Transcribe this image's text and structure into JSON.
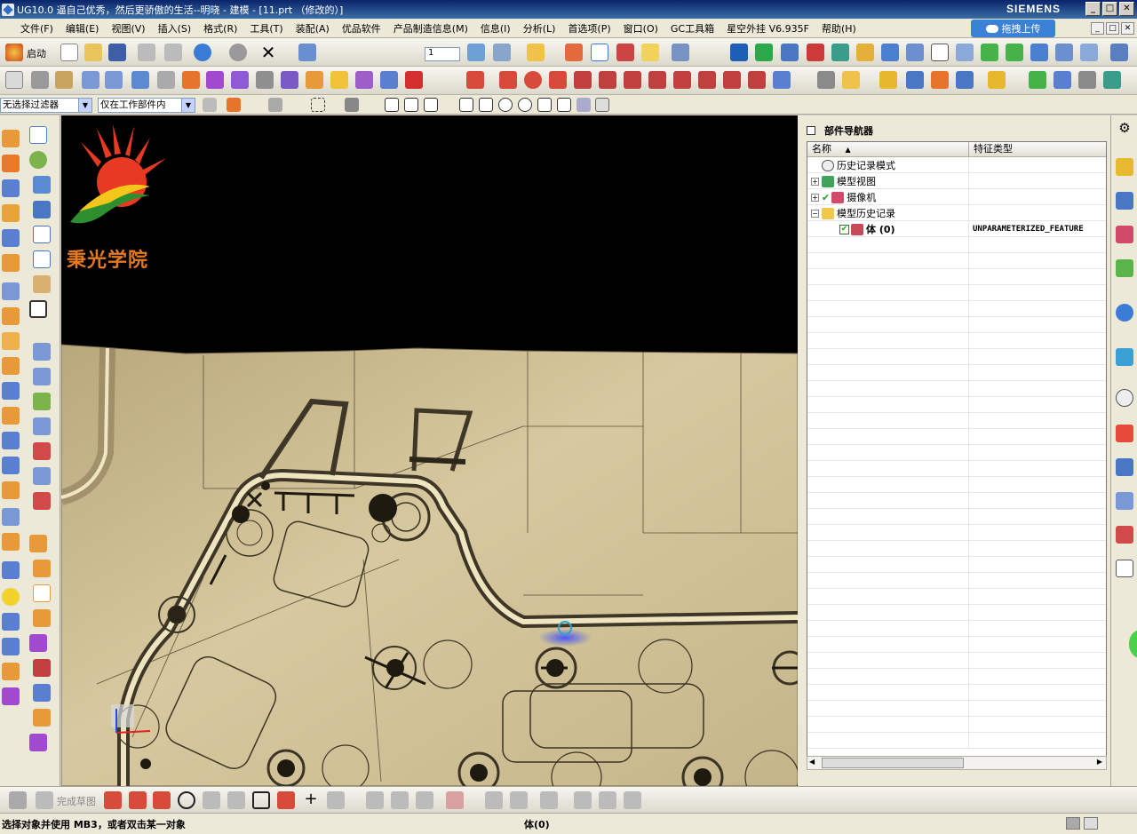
{
  "window": {
    "title": "UG10.0 逼自己优秀，然后更骄傲的生活--明晓 - 建模 - [11.prt （修改的）]",
    "brand": "SIEMENS",
    "minimize": "_",
    "maximize": "□",
    "close": "✕"
  },
  "menu": {
    "items": [
      "文件(F)",
      "编辑(E)",
      "视图(V)",
      "插入(S)",
      "格式(R)",
      "工具(T)",
      "装配(A)",
      "优品软件",
      "产品制造信息(M)",
      "信息(I)",
      "分析(L)",
      "首选项(P)",
      "窗口(O)",
      "GC工具箱",
      "星空外挂 V6.935F",
      "帮助(H)"
    ],
    "upload_label": "拖拽上传"
  },
  "toolbar": {
    "start_label": "启动",
    "layer_value": "1"
  },
  "selection_bar": {
    "filter_value": "无选择过滤器",
    "scope_value": "仅在工作部件内"
  },
  "viewport": {
    "logo_text": "秉光学院"
  },
  "navigator": {
    "title": "部件导航器",
    "col_name": "名称",
    "col_type": "特征类型",
    "rows": [
      {
        "label": "历史记录模式",
        "type": ""
      },
      {
        "label": "模型视图",
        "type": ""
      },
      {
        "label": "摄像机",
        "type": ""
      },
      {
        "label": "模型历史记录",
        "type": ""
      },
      {
        "label": "体 (0)",
        "type": "UNPARAMETERIZED_FEATURE"
      }
    ]
  },
  "sketch_bar": {
    "finish_label": "完成草图"
  },
  "status": {
    "cue": "选择对象并使用 MB3，或者双击某一对象",
    "selection": "体(0)"
  },
  "colors": {
    "title_bg": "#0a246a",
    "viewport_bg": "#000000",
    "part_face": "#c9b98f",
    "upload_btn": "#3b82d6"
  }
}
